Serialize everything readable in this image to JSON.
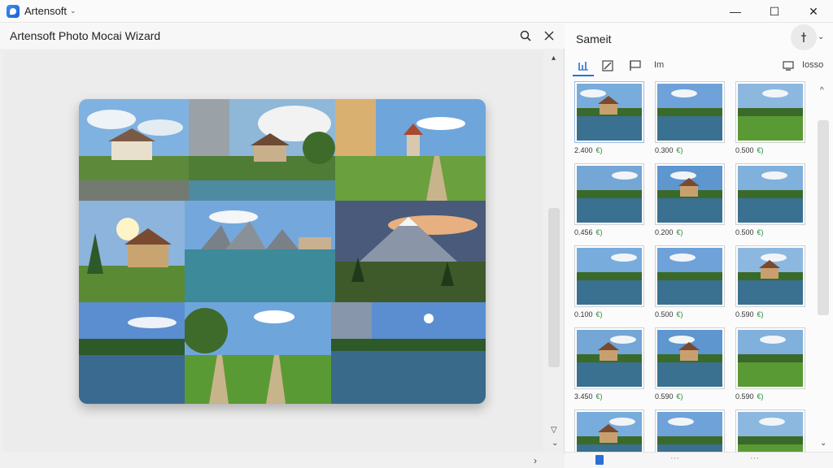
{
  "app": {
    "name": "Artensoft",
    "caret": "⌄"
  },
  "window_controls": {
    "minimize": "—",
    "maximize": "☐",
    "close": "✕"
  },
  "wizard": {
    "title": "Artensoft Photo Mocai Wizard"
  },
  "right_panel": {
    "title": "Sameit",
    "toolbar_text": "Im",
    "toolbar_right_text": "Iosso",
    "thumbnails": [
      {
        "value": "2.400",
        "unit": "€)"
      },
      {
        "value": "0.300",
        "unit": "€)"
      },
      {
        "value": "0.500",
        "unit": "€)"
      },
      {
        "value": "0.456",
        "unit": "€)"
      },
      {
        "value": "0.200",
        "unit": "€)"
      },
      {
        "value": "0.500",
        "unit": "€)"
      },
      {
        "value": "0.100",
        "unit": "€)"
      },
      {
        "value": "0.500",
        "unit": "€)"
      },
      {
        "value": "0.590",
        "unit": "€)"
      },
      {
        "value": "3.450",
        "unit": "€)"
      },
      {
        "value": "0.590",
        "unit": "€)"
      },
      {
        "value": "0.590",
        "unit": "€)"
      },
      {
        "value": "",
        "unit": ""
      },
      {
        "value": "",
        "unit": ""
      },
      {
        "value": "",
        "unit": ""
      }
    ]
  },
  "colors": {
    "accent": "#2c6fd6",
    "unit_green": "#2a8a3a"
  }
}
